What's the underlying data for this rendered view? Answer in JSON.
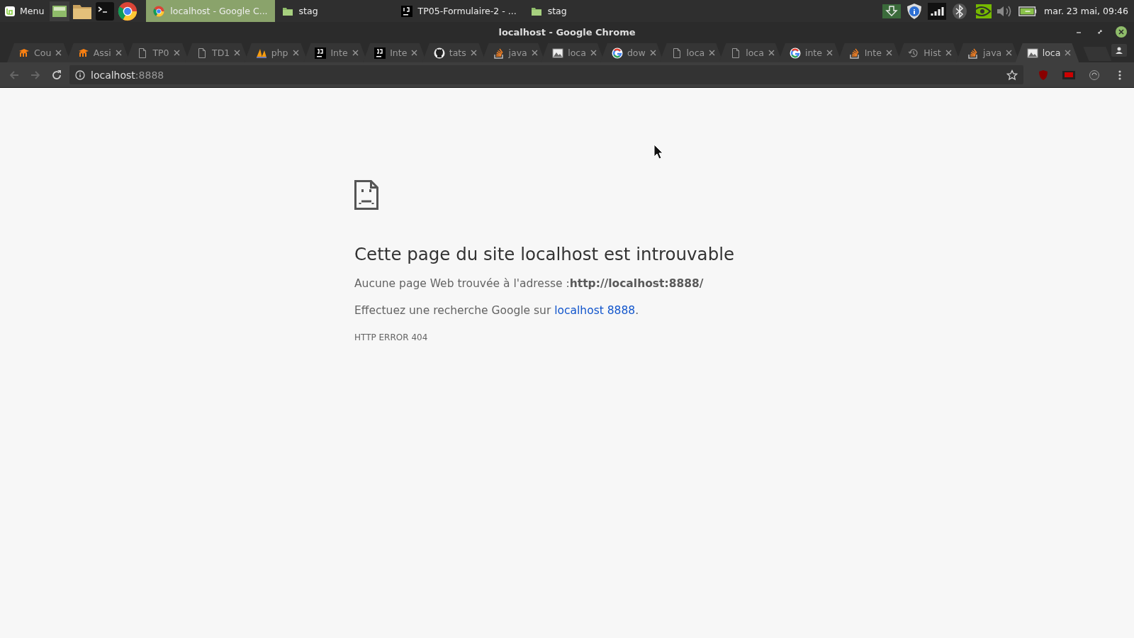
{
  "taskbar": {
    "menu_label": "Menu",
    "windows": [
      {
        "title": "localhost - Google C...",
        "kind": "chrome",
        "selected": true
      },
      {
        "title": "stag",
        "kind": "folder",
        "selected": false
      },
      {
        "title": "TP05-Formulaire-2 - ...",
        "kind": "jetbrains",
        "selected": false
      },
      {
        "title": "stag",
        "kind": "folder",
        "selected": false
      }
    ],
    "clock": "mar. 23 mai, 09:46"
  },
  "window": {
    "title": "localhost - Google Chrome"
  },
  "tabs": [
    {
      "label": "Cou",
      "kind": "moodle",
      "selected": false
    },
    {
      "label": "Assi",
      "kind": "moodle",
      "selected": false
    },
    {
      "label": "TP0",
      "kind": "file",
      "selected": false
    },
    {
      "label": "TD1",
      "kind": "file",
      "selected": false
    },
    {
      "label": "php",
      "kind": "pma",
      "selected": false
    },
    {
      "label": "Inte",
      "kind": "jetbrains",
      "selected": false
    },
    {
      "label": "Inte",
      "kind": "jetbrains",
      "selected": false
    },
    {
      "label": "tats",
      "kind": "github",
      "selected": false
    },
    {
      "label": "java",
      "kind": "stack",
      "selected": false
    },
    {
      "label": "loca",
      "kind": "image",
      "selected": false
    },
    {
      "label": "dow",
      "kind": "google",
      "selected": false
    },
    {
      "label": "loca",
      "kind": "file",
      "selected": false
    },
    {
      "label": "loca",
      "kind": "file",
      "selected": false
    },
    {
      "label": "inte",
      "kind": "google",
      "selected": false
    },
    {
      "label": "Inte",
      "kind": "stack",
      "selected": false
    },
    {
      "label": "Hist",
      "kind": "history",
      "selected": false
    },
    {
      "label": "java",
      "kind": "stack",
      "selected": false
    },
    {
      "label": "loca",
      "kind": "image",
      "selected": true
    }
  ],
  "address_bar": {
    "host": "localhost",
    "port": ":8888"
  },
  "error_page": {
    "heading": "Cette page du site localhost est introuvable",
    "message": "Aucune page Web trouvée à l'adresse :**http://localhost:8888/**",
    "search_prefix": "Effectuez une recherche Google sur ",
    "search_link": "localhost 8888",
    "search_suffix": ".",
    "error_code": "HTTP ERROR 404"
  }
}
